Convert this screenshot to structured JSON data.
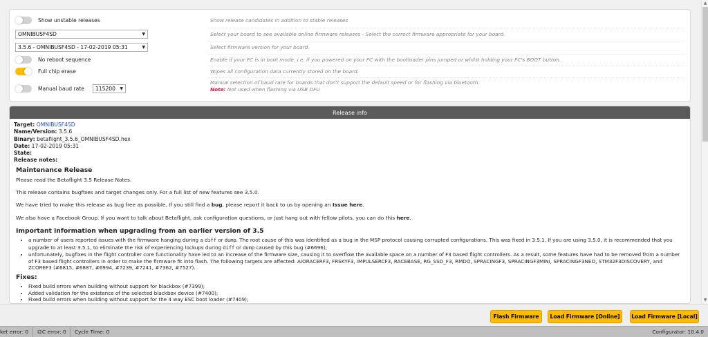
{
  "options": {
    "unstable": {
      "label": "Show unstable releases",
      "desc": "Show release candidates in addition to stable releases",
      "on": false
    },
    "board": {
      "value": "OMNIBUSF4SD",
      "desc": "Select your board to see available online firmware releases - Select the correct firmware appropriate for your board."
    },
    "version": {
      "value": "3.5.6 - OMNIBUSF4SD - 17-02-2019 05:31",
      "desc": "Select firmware version for your board."
    },
    "no_reboot": {
      "label": "No reboot sequence",
      "desc": "Enable if your FC is in boot mode. i.e. if you powered on your FC with the bootloader pins jumped or whilst holding your FC's BOOT button.",
      "on": false
    },
    "full_chip_erase": {
      "label": "Full chip erase",
      "desc": "Wipes all configuration data currently stored on the board.",
      "on": true
    },
    "manual_baud": {
      "label": "Manual baud rate",
      "value": "115200",
      "desc": "Manual selection of baud rate for boards that don't support the default speed or for flashing via bluetooth.",
      "note_label": "Note:",
      "note_text": " Not used when flashing via USB DFU",
      "on": false
    }
  },
  "release": {
    "header": "Release info",
    "target_label": "Target:",
    "target_value": "OMNIBUSF4SD",
    "name_label": "Name/Version:",
    "name_value": "3.5.6",
    "binary_label": "Binary:",
    "binary_value": "betaflight_3.5.6_OMNIBUSF4SD.hex",
    "date_label": "Date:",
    "date_value": "17-02-2019 05:31",
    "state_label": "State:",
    "notes_label": "Release notes:",
    "notes": {
      "maintenance_title": "Maintenance Release",
      "p1": "Please read the Betaflight 3.5 Release Notes.",
      "p2": "This release contains bugfixes and target changes only. For a full list of new features see 3.5.0.",
      "p3a": "We have tried to make this release as bug free as possible. If you still find a ",
      "p3b": "bug",
      "p3c": ", please report it back to us by opening an ",
      "p3d": "Issue here",
      "p3e": ".",
      "p4a": "We also have a Facebook Group. If you want to talk about Betaflight, ask configuration questions, or just hang out with fellow pilots, you can do this ",
      "p4b": "here",
      "p4c": ".",
      "important_title": "Important information when upgrading from an earlier version of 3.5",
      "imp1a": "a number of users reported issues with the firmware hanging during a ",
      "imp1_code1": "diff",
      "imp1b": " or ",
      "imp1_code2": "dump",
      "imp1c": ". The root cause of this was identified as a bug in the MSP protocol causing corrupted configurations. This was fixed in 3.5.1. If you are using 3.5.0, it is recommended that you upgrade to at least 3.5.1, to eliminate the risk of experiencing lockups during ",
      "imp1_code3": "diff",
      "imp1d": " or ",
      "imp1_code4": "dump",
      "imp1e": " caused by this bug (#6696);",
      "imp2": "unfortunately, bugfixes in the flight controller core functionality have led to an increase of the firmware size, causing it to overflow the available space on a number of F3 based flight controllers. As a result, some features have had to be removed from a number of F3 based flight controllers in order to make the firmware fit into flash. The following targets are affected: AIORACERF3, FRSKYF3, IMPULSERCF3, RACEBASE, RG_SSD_F3, RMDO, SPRACINGF3, SPRACINGF3MINI, SPRACINGF3NEO, STM32F3DISCOVERY, and ZCOREF3 (#6815, #6887, #6994, #7239, #7241, #7362, #7527).",
      "fixes_title": "Fixes:",
      "fixes": [
        "Fixed build errors when building without support for blackbox (#7399);",
        "Added validation for the existence of the selected blackbox device (#7400);",
        "Fixed build errors when building without support for the 4 way ESC boot loader (#7409);"
      ]
    }
  },
  "buttons": {
    "flash": "Flash Firmware",
    "load_online": "Load Firmware [Online]",
    "load_local": "Load Firmware [Local]"
  },
  "status": {
    "packet_error": "ket error: 0",
    "i2c_error": "I2C error: 0",
    "cycle_time": "Cycle Time: 0",
    "configurator": "Configurator: 10.4.0"
  },
  "colors": {
    "accent": "#ffbb00",
    "header": "#5a5a5a",
    "link": "#1e4bd2",
    "note": "#e2123f"
  }
}
